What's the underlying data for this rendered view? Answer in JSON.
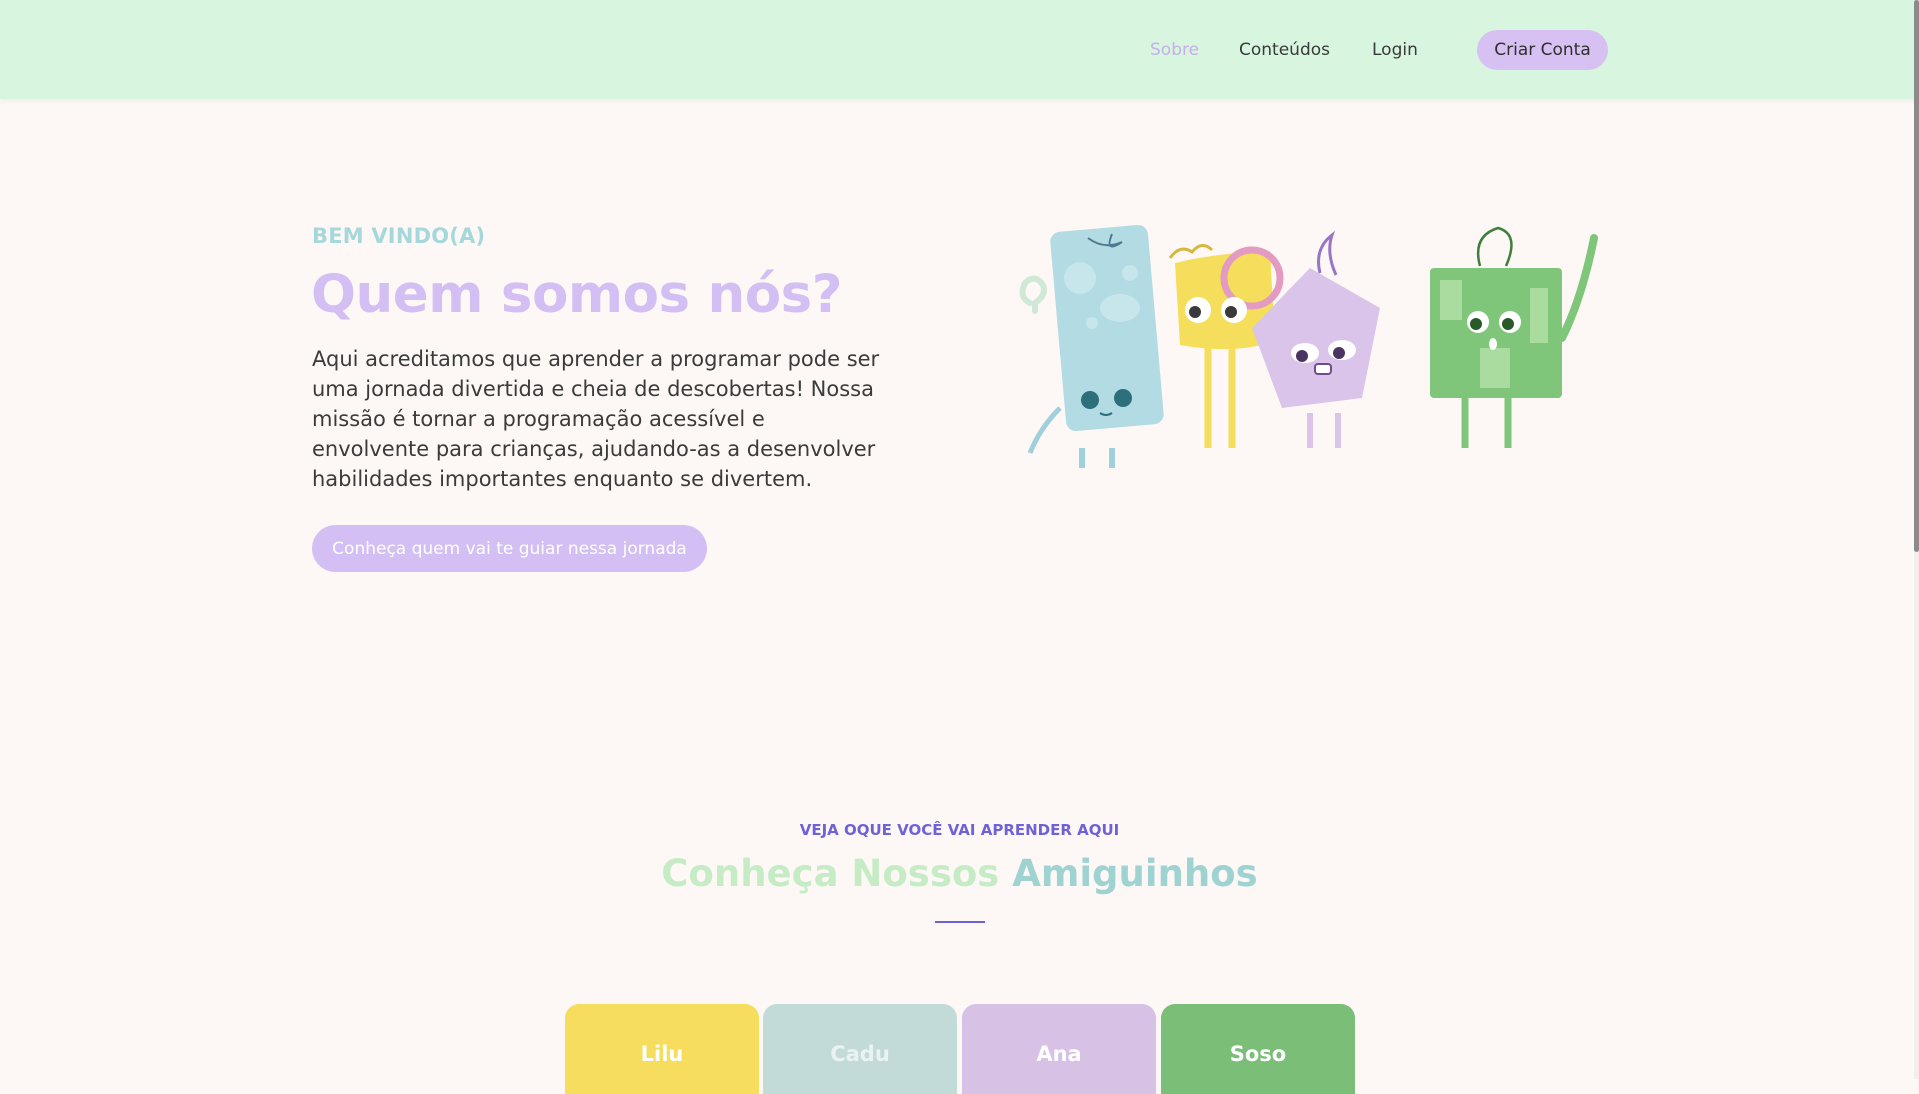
{
  "nav": {
    "items": [
      {
        "label": "Sobre"
      },
      {
        "label": "Conteúdos"
      },
      {
        "label": "Login"
      }
    ],
    "cta_label": "Criar Conta"
  },
  "hero": {
    "eyebrow": "BEM VINDO(A)",
    "title": "Quem somos nós?",
    "paragraph": "Aqui acreditamos que aprender a programar pode ser uma jornada divertida e cheia de descobertas! Nossa missão é tornar a programação acessível e envolvente para crianças, ajudando-as a desenvolver habilidades importantes enquanto se divertem.",
    "button_label": "Conheça quem vai te guiar nessa jornada"
  },
  "friends": {
    "eyebrow": "VEJA OQUE VOCÊ VAI APRENDER AQUI",
    "title_part1": "Conheça Nossos",
    "title_part2": "Amiguinhos",
    "cards": [
      {
        "name": "Lilu"
      },
      {
        "name": "Cadu"
      },
      {
        "name": "Ana"
      },
      {
        "name": "Soso"
      }
    ]
  },
  "colors": {
    "header_bg": "#d8f5df",
    "accent_purple": "#d3bff3",
    "teal": "#a6d8db",
    "indigo": "#6f62d6",
    "yellow": "#f6dd5e",
    "mint": "#c2dbd8",
    "lilac": "#d7c2e6",
    "green": "#7abe77"
  }
}
